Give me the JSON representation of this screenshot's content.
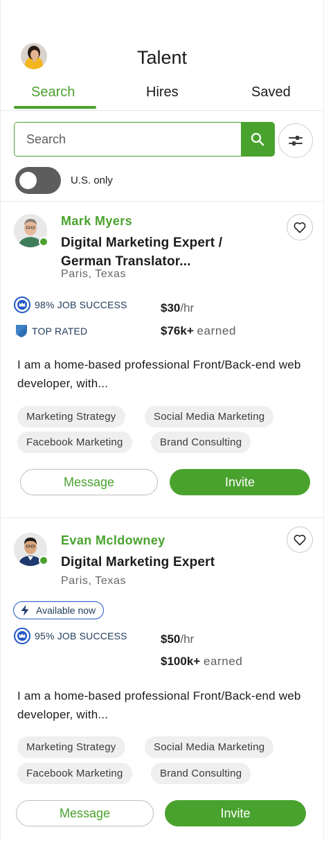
{
  "header": {
    "title": "Talent",
    "tabs": [
      {
        "label": "Search",
        "active": true
      },
      {
        "label": "Hires",
        "active": false
      },
      {
        "label": "Saved",
        "active": false
      }
    ]
  },
  "search": {
    "placeholder": "Search",
    "value": ""
  },
  "filter": {
    "us_only_label": "U.S. only",
    "us_only_enabled": false
  },
  "freelancers": [
    {
      "name": "Mark Myers",
      "headline": "Digital Marketing Expert / German Translator...",
      "location": "Paris, Texas",
      "online": true,
      "available_now": null,
      "job_success": "98% JOB SUCCESS",
      "top_rated": "TOP RATED",
      "rate_amount": "$30",
      "rate_unit": "/hr",
      "earned_amount": "$76k+",
      "earned_unit": "earned",
      "bio": "I am a home-based professional Front/Back-end web developer, with...",
      "skills": [
        "Marketing Strategy",
        "Social Media Marketing",
        "Facebook Marketing",
        "Brand Consulting"
      ],
      "message_label": "Message",
      "invite_label": "Invite"
    },
    {
      "name": "Evan Mcldowney",
      "headline": "Digital Marketing Expert",
      "location": "Paris, Texas",
      "online": true,
      "available_now": "Available now",
      "job_success": "95% JOB SUCCESS",
      "top_rated": null,
      "rate_amount": "$50",
      "rate_unit": "/hr",
      "earned_amount": "$100k+",
      "earned_unit": "earned",
      "bio": "I am a home-based professional Front/Back-end web developer, with...",
      "skills": [
        "Marketing Strategy",
        "Social Media Marketing",
        "Facebook Marketing",
        "Brand Consulting"
      ],
      "message_label": "Message",
      "invite_label": "Invite"
    }
  ],
  "colors": {
    "brand_green": "#4aa22e",
    "badge_blue": "#1f57c3",
    "toggle_off": "#5d5d5d",
    "chip_bg": "#efefef"
  },
  "icons": {
    "search": "search-icon",
    "filter": "sliders-icon",
    "favorite": "heart-icon",
    "job_success": "crown-badge-icon",
    "top_rated": "shield-badge-icon",
    "available": "lightning-icon"
  }
}
